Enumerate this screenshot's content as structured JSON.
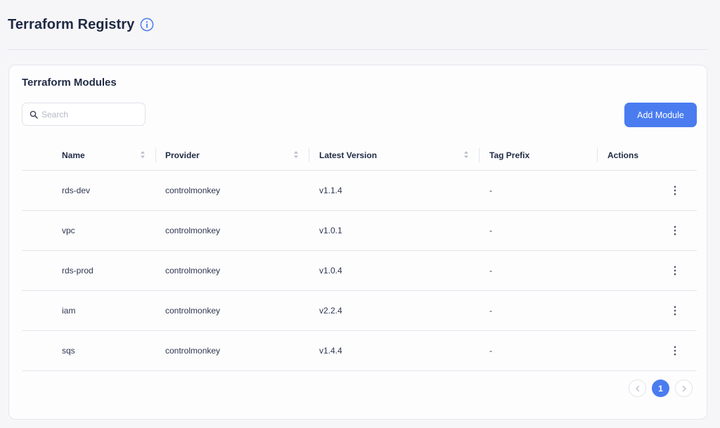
{
  "page": {
    "title": "Terraform Registry",
    "info_icon": "info-circle-icon"
  },
  "card": {
    "title": "Terraform Modules",
    "search": {
      "placeholder": "Search",
      "value": ""
    },
    "add_button_label": "Add Module"
  },
  "table": {
    "columns": [
      "Name",
      "Provider",
      "Latest Version",
      "Tag Prefix",
      "Actions"
    ],
    "rows": [
      {
        "name": "rds-dev",
        "provider": "controlmonkey",
        "version": "v1.1.4",
        "tag_prefix": "-"
      },
      {
        "name": "vpc",
        "provider": "controlmonkey",
        "version": "v1.0.1",
        "tag_prefix": "-"
      },
      {
        "name": "rds-prod",
        "provider": "controlmonkey",
        "version": "v1.0.4",
        "tag_prefix": "-"
      },
      {
        "name": "iam",
        "provider": "controlmonkey",
        "version": "v2.2.4",
        "tag_prefix": "-"
      },
      {
        "name": "sqs",
        "provider": "controlmonkey",
        "version": "v1.4.4",
        "tag_prefix": "-"
      }
    ]
  },
  "pagination": {
    "current_page": "1"
  },
  "colors": {
    "accent": "#4a7cf0",
    "text": "#1f2a44",
    "border": "#e3e5ea"
  }
}
